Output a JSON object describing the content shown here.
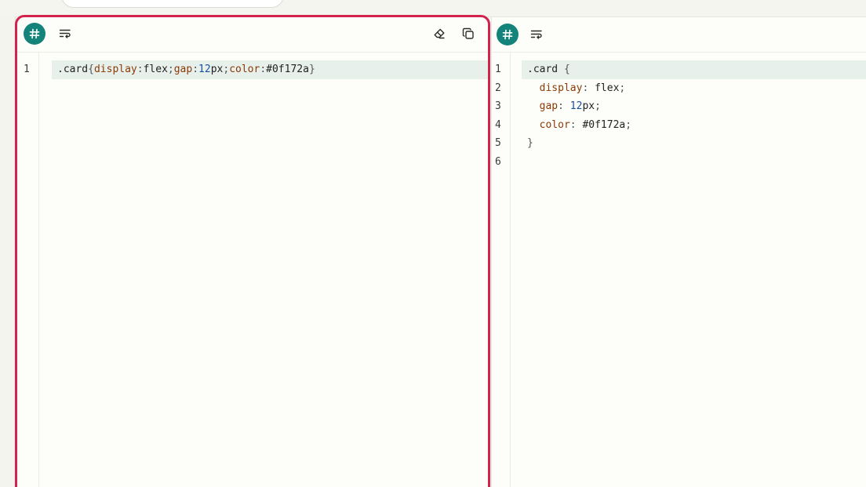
{
  "colors": {
    "accent": "#14837a",
    "highlight_border": "#d4224e",
    "property": "#8a3a06",
    "number": "#1a4f9c"
  },
  "left_pane": {
    "language_icon": "hash-icon",
    "toolbar": {
      "wrap_icon": "wrap-lines-icon",
      "clear_icon": "eraser-icon",
      "copy_icon": "copy-icon"
    },
    "line_numbers": [
      "1"
    ],
    "lines": [
      [
        {
          "t": ".card",
          "c": "tok-text"
        },
        {
          "t": "{",
          "c": "tok-punc"
        },
        {
          "t": "display",
          "c": "tok-prop"
        },
        {
          "t": ":",
          "c": "tok-punc"
        },
        {
          "t": "flex",
          "c": "tok-text"
        },
        {
          "t": ";",
          "c": "tok-punc"
        },
        {
          "t": "gap",
          "c": "tok-prop"
        },
        {
          "t": ":",
          "c": "tok-punc"
        },
        {
          "t": "12",
          "c": "tok-num"
        },
        {
          "t": "px",
          "c": "tok-text"
        },
        {
          "t": ";",
          "c": "tok-punc"
        },
        {
          "t": "color",
          "c": "tok-prop"
        },
        {
          "t": ":",
          "c": "tok-punc"
        },
        {
          "t": "#0f172a",
          "c": "tok-text"
        },
        {
          "t": "}",
          "c": "tok-punc"
        }
      ]
    ]
  },
  "right_pane": {
    "language_icon": "hash-icon",
    "toolbar": {
      "wrap_icon": "wrap-lines-icon"
    },
    "line_numbers": [
      "1",
      "2",
      "3",
      "4",
      "5",
      "6"
    ],
    "lines": [
      [
        {
          "t": ".card ",
          "c": "tok-text"
        },
        {
          "t": "{",
          "c": "tok-punc"
        }
      ],
      [
        {
          "t": "  ",
          "c": "tok-text"
        },
        {
          "t": "display",
          "c": "tok-prop"
        },
        {
          "t": ": ",
          "c": "tok-punc"
        },
        {
          "t": "flex",
          "c": "tok-text"
        },
        {
          "t": ";",
          "c": "tok-punc"
        }
      ],
      [
        {
          "t": "  ",
          "c": "tok-text"
        },
        {
          "t": "gap",
          "c": "tok-prop"
        },
        {
          "t": ": ",
          "c": "tok-punc"
        },
        {
          "t": "12",
          "c": "tok-num"
        },
        {
          "t": "px",
          "c": "tok-text"
        },
        {
          "t": ";",
          "c": "tok-punc"
        }
      ],
      [
        {
          "t": "  ",
          "c": "tok-text"
        },
        {
          "t": "color",
          "c": "tok-prop"
        },
        {
          "t": ": ",
          "c": "tok-punc"
        },
        {
          "t": "#0f172a",
          "c": "tok-text"
        },
        {
          "t": ";",
          "c": "tok-punc"
        }
      ],
      [
        {
          "t": "}",
          "c": "tok-punc"
        }
      ],
      []
    ]
  }
}
